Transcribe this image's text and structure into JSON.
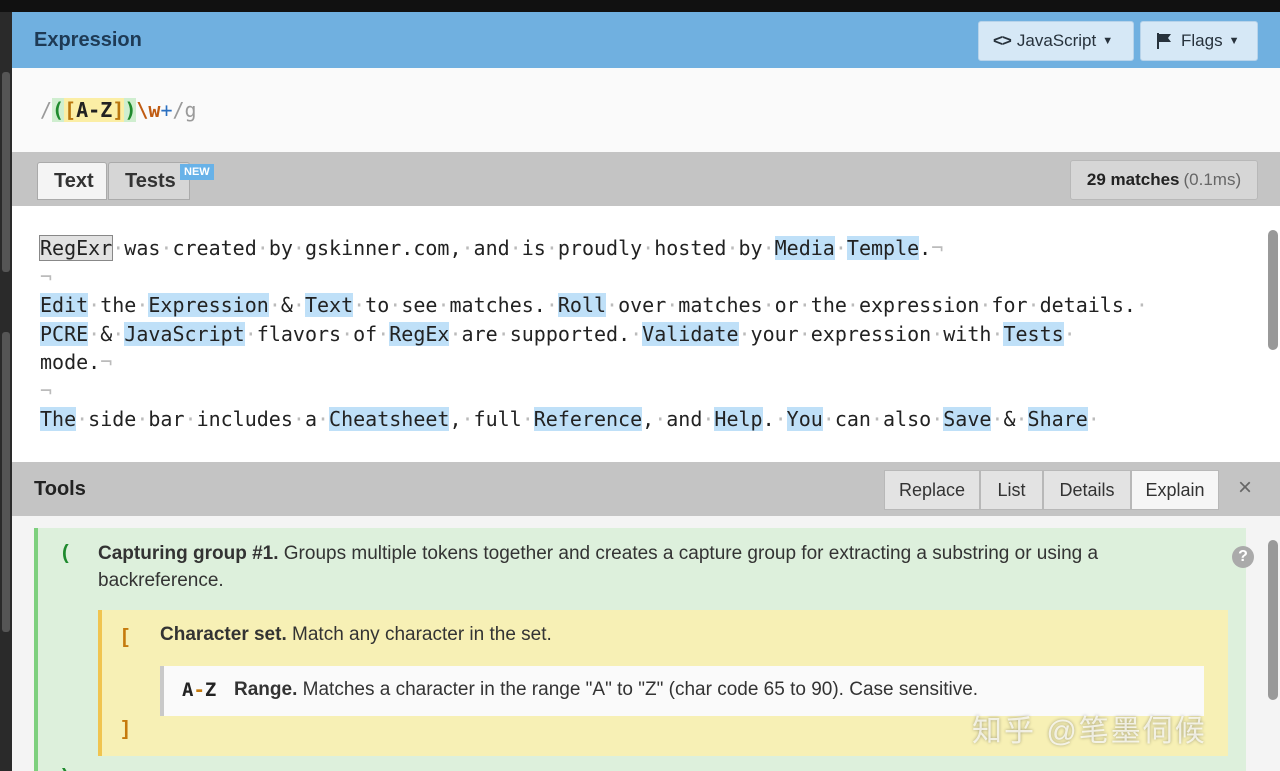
{
  "expression": {
    "title": "Expression",
    "lang_label": "JavaScript",
    "flags_label": "Flags",
    "regex": {
      "open_slash": "/",
      "group_open": "(",
      "set_open": "[",
      "range": "A-Z",
      "set_close": "]",
      "group_close": ")",
      "escape": "\\w",
      "quant": "+",
      "close_slash": "/",
      "flags": "g"
    }
  },
  "tabs": {
    "text": "Text",
    "tests": "Tests",
    "new_badge": "NEW",
    "match_count": "29 matches",
    "match_time": "(0.1ms)"
  },
  "text_lines": [
    [
      {
        "t": "RegExr",
        "m": 2
      },
      {
        "t": "·",
        "d": 1
      },
      {
        "t": "was"
      },
      {
        "t": "·",
        "d": 1
      },
      {
        "t": "created"
      },
      {
        "t": "·",
        "d": 1
      },
      {
        "t": "by"
      },
      {
        "t": "·",
        "d": 1
      },
      {
        "t": "gskinner.com,"
      },
      {
        "t": "·",
        "d": 1
      },
      {
        "t": "and"
      },
      {
        "t": "·",
        "d": 1
      },
      {
        "t": "is"
      },
      {
        "t": "·",
        "d": 1
      },
      {
        "t": "proudly"
      },
      {
        "t": "·",
        "d": 1
      },
      {
        "t": "hosted"
      },
      {
        "t": "·",
        "d": 1
      },
      {
        "t": "by"
      },
      {
        "t": "·",
        "d": 1
      },
      {
        "t": "Media",
        "m": 1
      },
      {
        "t": "·",
        "d": 1
      },
      {
        "t": "Temple",
        "m": 1
      },
      {
        "t": "."
      },
      {
        "t": "¬",
        "d": 1
      }
    ],
    [
      {
        "t": "¬",
        "d": 1
      }
    ],
    [
      {
        "t": "Edit",
        "m": 1
      },
      {
        "t": "·",
        "d": 1
      },
      {
        "t": "the"
      },
      {
        "t": "·",
        "d": 1
      },
      {
        "t": "Expression",
        "m": 1
      },
      {
        "t": "·",
        "d": 1
      },
      {
        "t": "&"
      },
      {
        "t": "·",
        "d": 1
      },
      {
        "t": "Text",
        "m": 1
      },
      {
        "t": "·",
        "d": 1
      },
      {
        "t": "to"
      },
      {
        "t": "·",
        "d": 1
      },
      {
        "t": "see"
      },
      {
        "t": "·",
        "d": 1
      },
      {
        "t": "matches."
      },
      {
        "t": "·",
        "d": 1
      },
      {
        "t": "Roll",
        "m": 1
      },
      {
        "t": "·",
        "d": 1
      },
      {
        "t": "over"
      },
      {
        "t": "·",
        "d": 1
      },
      {
        "t": "matches"
      },
      {
        "t": "·",
        "d": 1
      },
      {
        "t": "or"
      },
      {
        "t": "·",
        "d": 1
      },
      {
        "t": "the"
      },
      {
        "t": "·",
        "d": 1
      },
      {
        "t": "expression"
      },
      {
        "t": "·",
        "d": 1
      },
      {
        "t": "for"
      },
      {
        "t": "·",
        "d": 1
      },
      {
        "t": "details."
      },
      {
        "t": "·",
        "d": 1
      }
    ],
    [
      {
        "t": "PCRE",
        "m": 1
      },
      {
        "t": "·",
        "d": 1
      },
      {
        "t": "&"
      },
      {
        "t": "·",
        "d": 1
      },
      {
        "t": "JavaScript",
        "m": 1
      },
      {
        "t": "·",
        "d": 1
      },
      {
        "t": "flavors"
      },
      {
        "t": "·",
        "d": 1
      },
      {
        "t": "of"
      },
      {
        "t": "·",
        "d": 1
      },
      {
        "t": "RegEx",
        "m": 1
      },
      {
        "t": "·",
        "d": 1
      },
      {
        "t": "are"
      },
      {
        "t": "·",
        "d": 1
      },
      {
        "t": "supported."
      },
      {
        "t": "·",
        "d": 1
      },
      {
        "t": "Validate",
        "m": 1
      },
      {
        "t": "·",
        "d": 1
      },
      {
        "t": "your"
      },
      {
        "t": "·",
        "d": 1
      },
      {
        "t": "expression"
      },
      {
        "t": "·",
        "d": 1
      },
      {
        "t": "with"
      },
      {
        "t": "·",
        "d": 1
      },
      {
        "t": "Tests",
        "m": 1
      },
      {
        "t": "·",
        "d": 1
      }
    ],
    [
      {
        "t": "mode."
      },
      {
        "t": "¬",
        "d": 1
      }
    ],
    [
      {
        "t": "¬",
        "d": 1
      }
    ],
    [
      {
        "t": "The",
        "m": 1
      },
      {
        "t": "·",
        "d": 1
      },
      {
        "t": "side"
      },
      {
        "t": "·",
        "d": 1
      },
      {
        "t": "bar"
      },
      {
        "t": "·",
        "d": 1
      },
      {
        "t": "includes"
      },
      {
        "t": "·",
        "d": 1
      },
      {
        "t": "a"
      },
      {
        "t": "·",
        "d": 1
      },
      {
        "t": "Cheatsheet",
        "m": 1
      },
      {
        "t": ","
      },
      {
        "t": "·",
        "d": 1
      },
      {
        "t": "full"
      },
      {
        "t": "·",
        "d": 1
      },
      {
        "t": "Reference",
        "m": 1
      },
      {
        "t": ","
      },
      {
        "t": "·",
        "d": 1
      },
      {
        "t": "and"
      },
      {
        "t": "·",
        "d": 1
      },
      {
        "t": "Help",
        "m": 1
      },
      {
        "t": "."
      },
      {
        "t": "·",
        "d": 1
      },
      {
        "t": "You",
        "m": 1
      },
      {
        "t": "·",
        "d": 1
      },
      {
        "t": "can"
      },
      {
        "t": "·",
        "d": 1
      },
      {
        "t": "also"
      },
      {
        "t": "·",
        "d": 1
      },
      {
        "t": "Save",
        "m": 1
      },
      {
        "t": "·",
        "d": 1
      },
      {
        "t": "&"
      },
      {
        "t": "·",
        "d": 1
      },
      {
        "t": "Share",
        "m": 1
      },
      {
        "t": "·",
        "d": 1
      }
    ]
  ],
  "tools": {
    "title": "Tools",
    "tabs": [
      "Replace",
      "List",
      "Details",
      "Explain"
    ],
    "active_tab": "Explain",
    "close_icon": "×"
  },
  "explain": {
    "group": {
      "token_open": "(",
      "token_close": ")",
      "title": "Capturing group #1.",
      "desc": "Groups multiple tokens together and creates a capture group for extracting a substring or using a backreference.",
      "help": "?"
    },
    "set": {
      "token_open": "[",
      "token_close": "]",
      "title": "Character set.",
      "desc": "Match any character in the set."
    },
    "range": {
      "token_a": "A",
      "token_dash": "-",
      "token_z": "Z",
      "title": "Range.",
      "desc": "Matches a character in the range \"A\" to \"Z\" (char code 65 to 90). Case sensitive."
    }
  },
  "watermark": "知乎 @笔墨伺候",
  "colors": {
    "header_blue": "#70b0e0",
    "match_highlight": "#bfe0f8",
    "group_green": "#ddf0dc",
    "set_yellow": "#f7f0b5"
  }
}
